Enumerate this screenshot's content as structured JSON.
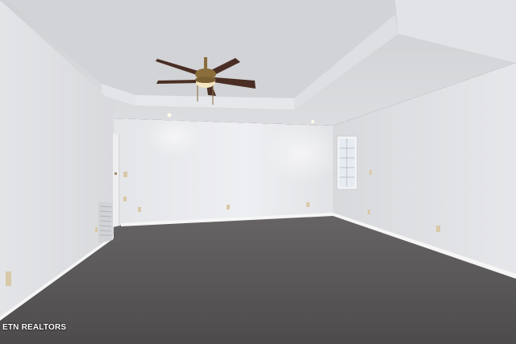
{
  "watermark": {
    "text": "ETN REALTORS"
  },
  "colors": {
    "wall_left": "#e1e2e5",
    "wall_back": "#e9eaed",
    "wall_right": "#dcdde0",
    "ceiling": "#d6d7da",
    "carpet": "#5a5758",
    "baseboard": "#f5f5f5",
    "fan_blade": "#4a2e24",
    "fan_brass": "#8a6d3b"
  },
  "icons": {
    "ceiling_fan": "ceiling-fan-icon",
    "window": "window-icon",
    "door": "door-icon",
    "vent": "air-vent-icon",
    "outlet": "outlet-icon",
    "recessed_light": "recessed-light-icon"
  }
}
